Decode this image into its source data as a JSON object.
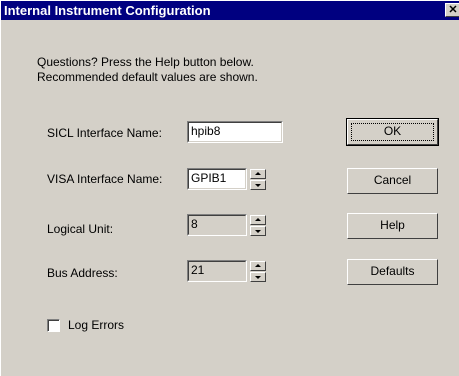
{
  "window": {
    "title": "Internal Instrument Configuration",
    "close_glyph": "✕"
  },
  "intro": {
    "line1": "Questions?  Press the Help button below.",
    "line2": "Recommended default values are shown."
  },
  "fields": {
    "sicl": {
      "label": "SICL Interface Name:",
      "value": "hpib8"
    },
    "visa": {
      "label": "VISA Interface Name:",
      "value": "GPIB1"
    },
    "logical_unit": {
      "label": "Logical Unit:",
      "value": "8"
    },
    "bus_address": {
      "label": "Bus Address:",
      "value": "21"
    }
  },
  "buttons": {
    "ok": "OK",
    "cancel": "Cancel",
    "help": "Help",
    "defaults": "Defaults"
  },
  "log_errors": {
    "label": "Log Errors",
    "checked": false
  },
  "icons": {
    "close": "close-icon",
    "spin_up": "arrow-up-icon",
    "spin_down": "arrow-down-icon"
  },
  "colors": {
    "titlebar": "#000080",
    "face": "#d4d0c8"
  }
}
